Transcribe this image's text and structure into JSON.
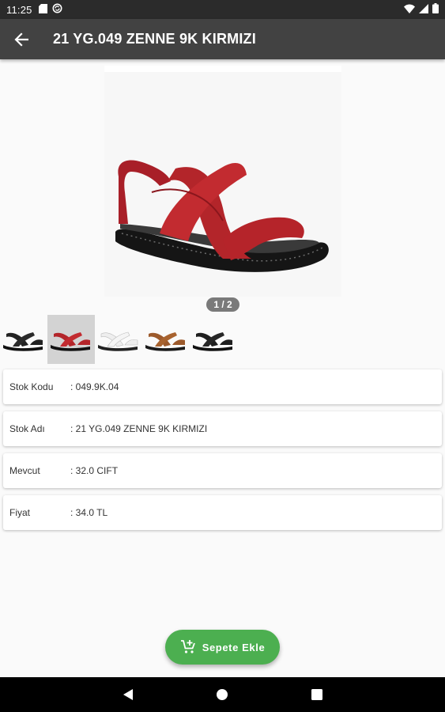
{
  "status_bar": {
    "time": "11:25"
  },
  "app_bar": {
    "title": "21 YG.049 ZENNE 9K KIRMIZI"
  },
  "gallery": {
    "pager": "1 / 2",
    "thumbnails": [
      {
        "color": "#222222"
      },
      {
        "color": "#b3252a"
      },
      {
        "color": "#f2f2f2"
      },
      {
        "color": "#9c5a2c"
      },
      {
        "color": "#1f1f1f"
      }
    ]
  },
  "details": [
    {
      "label": "Stok Kodu",
      "value": ": 049.9K.04"
    },
    {
      "label": "Stok Adı",
      "value": ": 21 YG.049 ZENNE 9K KIRMIZI"
    },
    {
      "label": "Mevcut",
      "value": ": 32.0 CIFT"
    },
    {
      "label": "Fiyat",
      "value": ": 34.0 TL"
    }
  ],
  "fab": {
    "label": "Sepete Ekle",
    "icon": "add-shopping-cart-icon",
    "color": "#4caf50"
  },
  "colors": {
    "app_bar": "#424242",
    "status_bar": "#2b2b2b",
    "product": "#b3252a"
  }
}
